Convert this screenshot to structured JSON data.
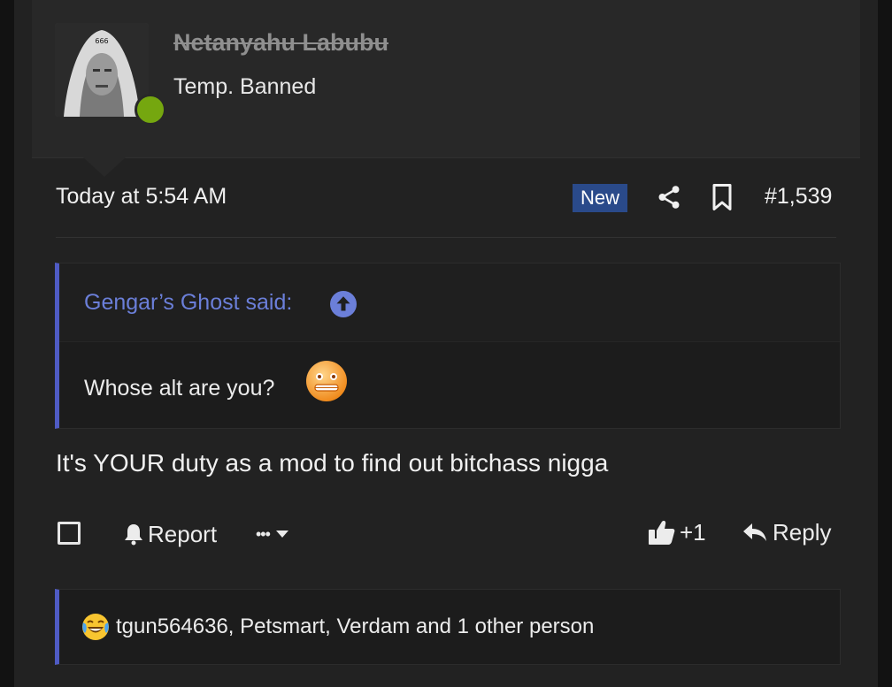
{
  "post": {
    "user": {
      "name": "Netanyahu Labubu",
      "title": "Temp. Banned",
      "avatar_text": "666",
      "status_color": "#75a70f"
    },
    "meta": {
      "date": "Today at 5:54 AM",
      "badge": "New",
      "post_number": "#1,539",
      "icons": [
        "share-icon",
        "bookmark-icon"
      ]
    },
    "quote": {
      "author": "Gengar’s Ghost said:",
      "text": "Whose alt are you?",
      "emoji": "grimacing-orange-face"
    },
    "message": "It's YOUR duty as a mod to find out bitchass nigga",
    "actions": {
      "report": "Report",
      "more": "•••",
      "like_count": "+1",
      "reply": "Reply"
    },
    "reactions": {
      "emoji": "crying-laughing-face",
      "text": "tgun564636, Petsmart, Verdam and 1 other person"
    },
    "colors": {
      "accent": "#4f5bc4",
      "link": "#6b7fd9",
      "badge": "#2a4a8a"
    }
  }
}
